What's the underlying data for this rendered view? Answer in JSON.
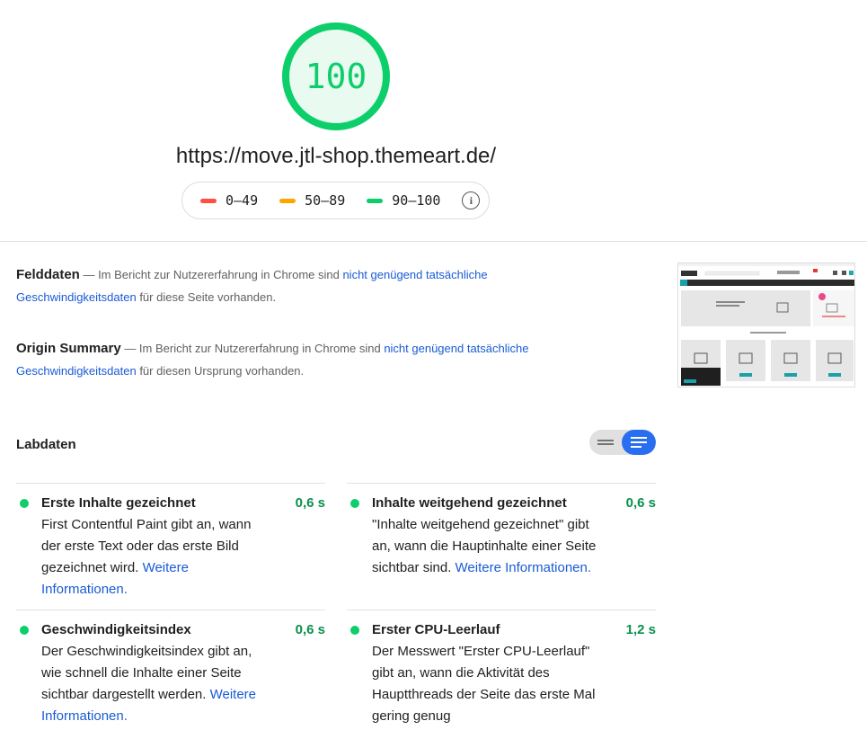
{
  "score": {
    "value": "100",
    "color": "#0cce6b"
  },
  "url": "https://move.jtl-shop.themeart.de/",
  "legend": {
    "items": [
      {
        "label": "0–49",
        "color": "#ff4e42"
      },
      {
        "label": "50–89",
        "color": "#ffa400"
      },
      {
        "label": "90–100",
        "color": "#0cce6b"
      }
    ],
    "info_icon": "info-icon"
  },
  "felddaten": {
    "title": "Felddaten",
    "text_before": " — Im Bericht zur Nutzererfahrung in Chrome sind ",
    "link": "nicht genügend tatsächliche Geschwindigkeitsdaten",
    "text_after": " für diese Seite vorhanden."
  },
  "origin": {
    "title": "Origin Summary",
    "text_before": " — Im Bericht zur Nutzererfahrung in Chrome sind ",
    "link": "nicht genügend tatsächliche Geschwindigkeitsdaten",
    "text_after": " für diesen Ursprung vorhanden."
  },
  "labdaten": {
    "title": "Labdaten"
  },
  "metrics": [
    {
      "title": "Erste Inhalte gezeichnet",
      "value": "0,6 s",
      "desc": "First Contentful Paint gibt an, wann der erste Text oder das erste Bild gezeichnet wird.",
      "link": "Weitere Informationen."
    },
    {
      "title": "Inhalte weitgehend gezeichnet",
      "value": "0,6 s",
      "desc": "\"Inhalte weitgehend gezeichnet\" gibt an, wann die Hauptinhalte einer Seite sichtbar sind.",
      "link": "Weitere Informationen."
    },
    {
      "title": "Geschwindigkeitsindex",
      "value": "0,6 s",
      "desc": "Der Geschwindigkeitsindex gibt an, wie schnell die Inhalte einer Seite sichtbar dargestellt werden.",
      "link": "Weitere Informationen."
    },
    {
      "title": "Erster CPU-Leerlauf",
      "value": "1,2 s",
      "desc": "Der Messwert \"Erster CPU-Leerlauf\" gibt an, wann die Aktivität des Hauptthreads der Seite das erste Mal gering genug",
      "link": ""
    }
  ],
  "colors": {
    "pass": "#0cce6b",
    "link": "#1a5bd6",
    "toggle_active": "#2a6ef0"
  }
}
